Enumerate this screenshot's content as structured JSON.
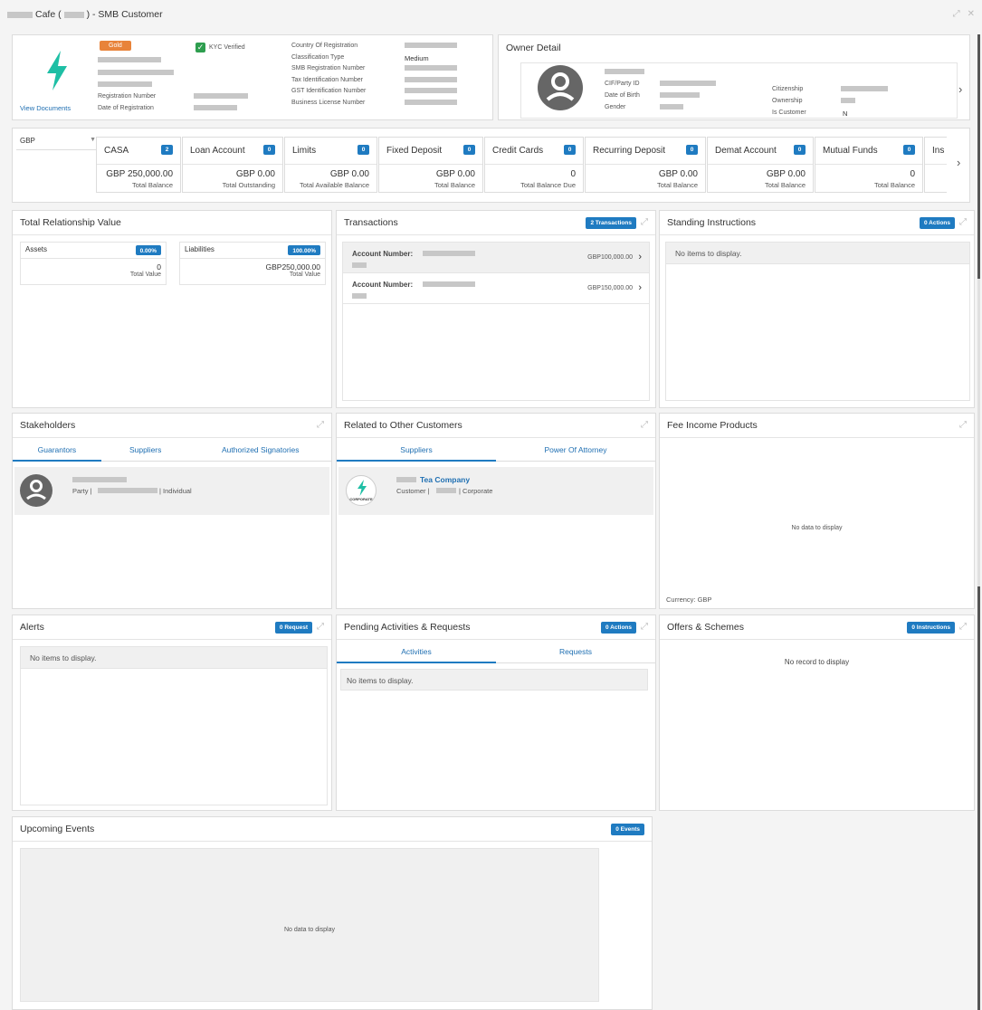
{
  "window": {
    "title_pre": "Cafe (",
    "title_post": ") - SMB Customer"
  },
  "profile": {
    "tier": "Gold",
    "kyc": "KYC Verified",
    "view_documents": "View Documents",
    "reg_number_label": "Registration Number",
    "reg_date_label": "Date of Registration",
    "fields": [
      {
        "label": "Country Of Registration",
        "value": ""
      },
      {
        "label": "Classification Type",
        "value": "Medium"
      },
      {
        "label": "SMB Registration Number",
        "value": ""
      },
      {
        "label": "Tax Identification Number",
        "value": ""
      },
      {
        "label": "GST Identification Number",
        "value": ""
      },
      {
        "label": "Business License Number",
        "value": ""
      }
    ]
  },
  "owner": {
    "title": "Owner Detail",
    "left_labels": [
      "CIF/Party ID",
      "Date of Birth",
      "Gender"
    ],
    "right_labels": [
      "Citizenship",
      "Ownership",
      "Is Customer"
    ],
    "is_customer": "N"
  },
  "accounts": {
    "currency": "GBP",
    "tiles": [
      {
        "title": "CASA",
        "count": "2",
        "value": "GBP 250,000.00",
        "label": "Total Balance"
      },
      {
        "title": "Loan Account",
        "count": "0",
        "value": "GBP 0.00",
        "label": "Total Outstanding"
      },
      {
        "title": "Limits",
        "count": "0",
        "value": "GBP 0.00",
        "label": "Total Available Balance"
      },
      {
        "title": "Fixed Deposit",
        "count": "0",
        "value": "GBP 0.00",
        "label": "Total Balance"
      },
      {
        "title": "Credit Cards",
        "count": "0",
        "value": "0",
        "label": "Total Balance Due"
      },
      {
        "title": "Recurring Deposit",
        "count": "0",
        "value": "GBP 0.00",
        "label": "Total Balance"
      },
      {
        "title": "Demat Account",
        "count": "0",
        "value": "GBP 0.00",
        "label": "Total Balance"
      },
      {
        "title": "Mutual Funds",
        "count": "0",
        "value": "0",
        "label": "Total Balance"
      },
      {
        "title": "Ins",
        "count": "",
        "value": "",
        "label": ""
      }
    ]
  },
  "trv": {
    "title": "Total Relationship Value",
    "assets": {
      "label": "Assets",
      "pct": "0.00%",
      "value": "0",
      "sub": "Total Value"
    },
    "liabilities": {
      "label": "Liabilities",
      "pct": "100.00%",
      "value": "GBP250,000.00",
      "sub": "Total Value"
    }
  },
  "transactions": {
    "title": "Transactions",
    "badge": "2 Transactions",
    "rows": [
      {
        "label": "Account Number:",
        "amount": "GBP100,000.00"
      },
      {
        "label": "Account Number:",
        "amount": "GBP150,000.00"
      }
    ]
  },
  "standing": {
    "title": "Standing Instructions",
    "badge": "0 Actions",
    "empty": "No items to display."
  },
  "stakeholders": {
    "title": "Stakeholders",
    "tabs": [
      "Guarantors",
      "Suppliers",
      "Authorized Signatories"
    ],
    "row": {
      "prefix": "Party |",
      "suffix": "| Individual"
    }
  },
  "related": {
    "title": "Related to Other Customers",
    "tabs": [
      "Suppliers",
      "Power Of Attorney"
    ],
    "row": {
      "name": "Tea Company",
      "prefix": "Customer |",
      "suffix": "| Corporate",
      "tag": "CORPORATE"
    }
  },
  "fee": {
    "title": "Fee Income Products",
    "empty": "No data to display",
    "currency": "Currency: GBP"
  },
  "alerts": {
    "title": "Alerts",
    "badge": "0 Request",
    "empty": "No items to display."
  },
  "pending": {
    "title": "Pending Activities & Requests",
    "badge": "0 Actions",
    "tabs": [
      "Activities",
      "Requests"
    ],
    "empty": "No items to display."
  },
  "offers": {
    "title": "Offers & Schemes",
    "badge": "0 Instructions",
    "empty": "No record to display"
  },
  "events": {
    "title": "Upcoming Events",
    "badge": "0 Events",
    "empty": "No data to display"
  },
  "colors": {
    "accent": "#1f7bc1",
    "gold": "#e8833a",
    "kyc": "#2e9e4f",
    "logo": "#1ebfa5"
  }
}
